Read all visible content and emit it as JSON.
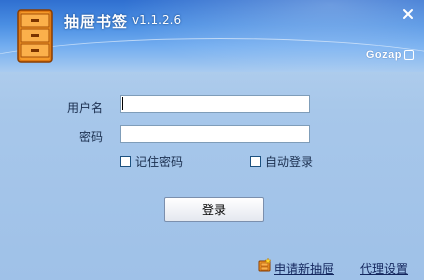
{
  "app": {
    "title": "抽屉书签",
    "version": "v1.1.2.6",
    "brand": "Gozap"
  },
  "window": {
    "close_glyph": "✕"
  },
  "form": {
    "username_label": "用户名",
    "username_value": "",
    "password_label": "密码",
    "password_value": "",
    "remember_password_label": "记住密码",
    "remember_password_checked": false,
    "auto_login_label": "自动登录",
    "auto_login_checked": false,
    "login_button_label": "登录"
  },
  "footer": {
    "register_link": "申请新抽屉",
    "proxy_link": "代理设置"
  },
  "icons": {
    "logo": "drawer-icon",
    "close": "close-icon",
    "brand": "gozap-logo-icon",
    "register": "new-drawer-icon"
  },
  "colors": {
    "header_top": "#2f6fd0",
    "body_bg": "#a7c7ea",
    "text": "#1b2f4f",
    "link": "#13255c"
  }
}
